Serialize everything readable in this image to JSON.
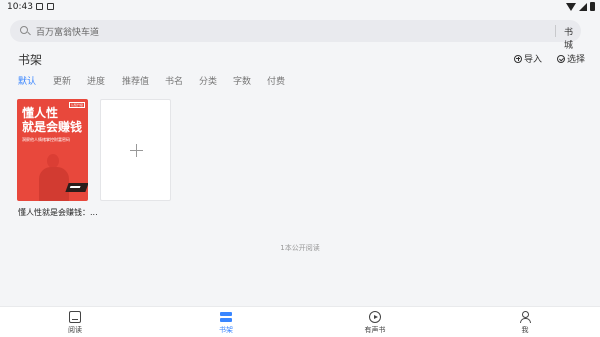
{
  "status_bar": {
    "time": "10:43"
  },
  "search": {
    "placeholder": "百万富翁快车道",
    "store_label": "书城"
  },
  "shelf": {
    "title": "书架",
    "import_label": "导入",
    "select_label": "选择"
  },
  "sort_tabs": [
    {
      "label": "默认",
      "active": true
    },
    {
      "label": "更新",
      "active": false
    },
    {
      "label": "进度",
      "active": false
    },
    {
      "label": "推荐值",
      "active": false
    },
    {
      "label": "书名",
      "active": false
    },
    {
      "label": "分类",
      "active": false
    },
    {
      "label": "字数",
      "active": false
    },
    {
      "label": "付费",
      "active": false
    }
  ],
  "books": [
    {
      "title": "懂人性就是会赚钱：...",
      "cover_title_line1": "懂人性",
      "cover_title_line2": "就是会赚钱",
      "cover_subtitle": "洞察他人情绪掌控财富密码",
      "cover_tag": "认知升级",
      "cover_color": "#e8483c"
    }
  ],
  "public_count": "1本公开阅读",
  "bottom_nav": [
    {
      "label": "阅读",
      "icon": "book-icon",
      "active": false
    },
    {
      "label": "书架",
      "icon": "shelf-icon",
      "active": true
    },
    {
      "label": "有声书",
      "icon": "play-circle-icon",
      "active": false
    },
    {
      "label": "我",
      "icon": "person-icon",
      "active": false
    }
  ],
  "colors": {
    "accent": "#3a86ff",
    "background": "#f4f5f7"
  }
}
